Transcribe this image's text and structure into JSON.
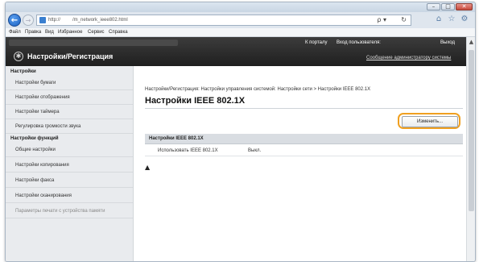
{
  "window": {
    "controls": {
      "minimize": "–",
      "maximize": "□",
      "close": "✕"
    }
  },
  "nav": {
    "url": "http://         /m_network_ieee802.html",
    "search_glyph": "ρ ▾",
    "refresh_glyph": "↻",
    "back_glyph": "←",
    "forward_glyph": "→"
  },
  "menu": [
    "Файл",
    "Правка",
    "Вид",
    "Избранное",
    "Сервис",
    "Справка"
  ],
  "header": {
    "portal_link": "К порталу",
    "login_label": "Вход пользователя:",
    "logout_link": "Выход",
    "title": "Настройки/Регистрация",
    "admin_message": "Сообщение администратору системы"
  },
  "sidebar": {
    "section1": "Настройки",
    "items1": [
      "Настройки бумаги",
      "Настройки отображения",
      "Настройки таймера",
      "Регулировка громкости звука"
    ],
    "section2": "Настройки функций",
    "items2": [
      "Общие настройки",
      "Настройки копирования",
      "Настройки факса",
      "Настройки сканирования",
      "Параметры печати с устройства памяти"
    ]
  },
  "main": {
    "breadcrumb": "Настройки/Регистрация: Настройки управления системой: Настройки сети > Настройки IEEE 802.1X",
    "page_title": "Настройки IEEE 802.1X",
    "edit_button": "Изменить...",
    "section_header": "Настройки IEEE 802.1X",
    "rows": [
      {
        "label": "Использовать IEEE 802.1X",
        "value": "Выкл."
      }
    ],
    "top_glyph": "▲"
  },
  "icons": {
    "back": "arrow-left-icon",
    "forward": "arrow-right-icon",
    "home": "home-icon",
    "favorites": "star-icon",
    "tools": "gear-icon",
    "logo": "settings-logo-icon",
    "top": "page-top-icon"
  },
  "colors": {
    "header_bg": "#2a2a2a",
    "highlight": "#f0a020",
    "sidebar_bg": "#e9ebee"
  }
}
